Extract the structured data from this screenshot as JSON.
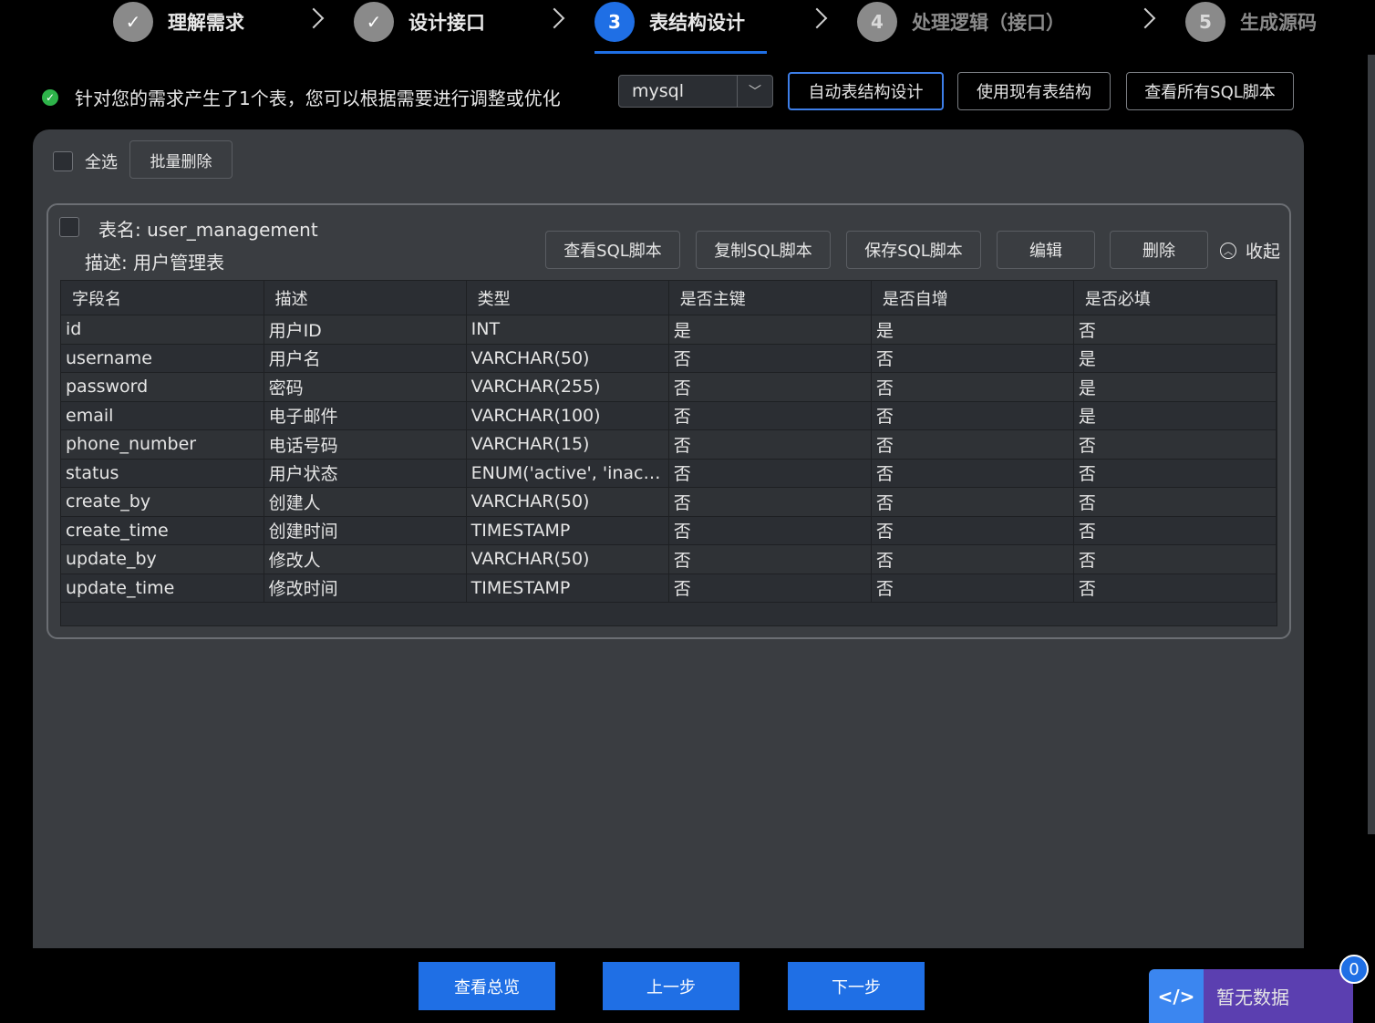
{
  "steps": [
    {
      "num": "✓",
      "label": "理解需求",
      "state": "done"
    },
    {
      "num": "✓",
      "label": "设计接口",
      "state": "done"
    },
    {
      "num": "3",
      "label": "表结构设计",
      "state": "active"
    },
    {
      "num": "4",
      "label": "处理逻辑（接口）",
      "state": "pending"
    },
    {
      "num": "5",
      "label": "生成源码",
      "state": "pending"
    }
  ],
  "info": {
    "message": "针对您的需求产生了1个表，您可以根据需要进行调整或优化"
  },
  "db_select": {
    "value": "mysql"
  },
  "toolbar": {
    "auto_design": "自动表结构设计",
    "use_existing": "使用现有表结构",
    "view_all_sql": "查看所有SQL脚本"
  },
  "panel": {
    "select_all": "全选",
    "batch_delete": "批量删除"
  },
  "table_card": {
    "name": "表名: user_management",
    "description": "描述: 用户管理表",
    "view_sql": "查看SQL脚本",
    "copy_sql": "复制SQL脚本",
    "save_sql": "保存SQL脚本",
    "edit": "编辑",
    "delete": "删除",
    "collapse": "收起",
    "columns": [
      "字段名",
      "描述",
      "类型",
      "是否主键",
      "是否自增",
      "是否必填"
    ],
    "rows": [
      [
        "id",
        "用户ID",
        "INT",
        "是",
        "是",
        "否"
      ],
      [
        "username",
        "用户名",
        "VARCHAR(50)",
        "否",
        "否",
        "是"
      ],
      [
        "password",
        "密码",
        "VARCHAR(255)",
        "否",
        "否",
        "是"
      ],
      [
        "email",
        "电子邮件",
        "VARCHAR(100)",
        "否",
        "否",
        "是"
      ],
      [
        "phone_number",
        "电话号码",
        "VARCHAR(15)",
        "否",
        "否",
        "否"
      ],
      [
        "status",
        "用户状态",
        "ENUM('active', 'inactiv...",
        "否",
        "否",
        "否"
      ],
      [
        "create_by",
        "创建人",
        "VARCHAR(50)",
        "否",
        "否",
        "否"
      ],
      [
        "create_time",
        "创建时间",
        "TIMESTAMP",
        "否",
        "否",
        "否"
      ],
      [
        "update_by",
        "修改人",
        "VARCHAR(50)",
        "否",
        "否",
        "否"
      ],
      [
        "update_time",
        "修改时间",
        "TIMESTAMP",
        "否",
        "否",
        "否"
      ]
    ]
  },
  "footer": {
    "overview": "查看总览",
    "prev": "上一步",
    "next": "下一步"
  },
  "floating": {
    "icon": "code-icon",
    "text": "暂无数据",
    "badge": "0"
  }
}
